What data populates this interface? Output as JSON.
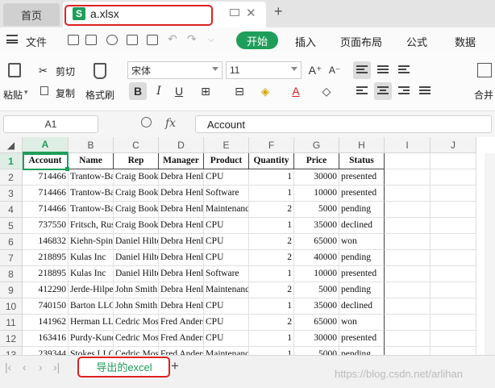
{
  "tabs": {
    "home": "首页",
    "file": "a.xlsx",
    "file_icon": "S",
    "close": "✕",
    "add": "+"
  },
  "menu": {
    "file": "文件",
    "start": "开始",
    "items": [
      "插入",
      "页面布局",
      "公式",
      "数据"
    ]
  },
  "ribbon": {
    "cut": "剪切",
    "copy": "复制",
    "paste": "粘贴",
    "format_painter": "格式刷",
    "font_name": "宋体",
    "font_size": "11",
    "bold": "B",
    "italic": "I",
    "underline": "U",
    "merge": "合并"
  },
  "formula": {
    "cell_ref": "A1",
    "fx": "fx",
    "content": "Account"
  },
  "columns": [
    "A",
    "B",
    "C",
    "D",
    "E",
    "F",
    "G",
    "H",
    "I",
    "J"
  ],
  "rows": [
    "1",
    "2",
    "3",
    "4",
    "5",
    "6",
    "7",
    "8",
    "9",
    "10",
    "11",
    "12",
    "13"
  ],
  "table": {
    "headers": [
      "Account",
      "Name",
      "Rep",
      "Manager",
      "Product",
      "Quantity",
      "Price",
      "Status"
    ],
    "data": [
      [
        "714466",
        "Trantow-Barrows",
        "Craig Booker",
        "Debra Henley",
        "CPU",
        "1",
        "30000",
        "presented"
      ],
      [
        "714466",
        "Trantow-Barrows",
        "Craig Booker",
        "Debra Henley",
        "Software",
        "1",
        "10000",
        "presented"
      ],
      [
        "714466",
        "Trantow-Barrows",
        "Craig Booker",
        "Debra Henley",
        "Maintenance",
        "2",
        "5000",
        "pending"
      ],
      [
        "737550",
        "Fritsch, Russel",
        "Craig Booker",
        "Debra Henley",
        "CPU",
        "1",
        "35000",
        "declined"
      ],
      [
        "146832",
        "Kiehn-Spinka",
        "Daniel Hilton",
        "Debra Henley",
        "CPU",
        "2",
        "65000",
        "won"
      ],
      [
        "218895",
        "Kulas Inc",
        "Daniel Hilton",
        "Debra Henley",
        "CPU",
        "2",
        "40000",
        "pending"
      ],
      [
        "218895",
        "Kulas Inc",
        "Daniel Hilton",
        "Debra Henley",
        "Software",
        "1",
        "10000",
        "presented"
      ],
      [
        "412290",
        "Jerde-Hilpert",
        "John Smith",
        "Debra Henley",
        "Maintenance",
        "2",
        "5000",
        "pending"
      ],
      [
        "740150",
        "Barton LLC",
        "John Smith",
        "Debra Henley",
        "CPU",
        "1",
        "35000",
        "declined"
      ],
      [
        "141962",
        "Herman LLC",
        "Cedric Moss",
        "Fred Anderson",
        "CPU",
        "2",
        "65000",
        "won"
      ],
      [
        "163416",
        "Purdy-Kunde",
        "Cedric Moss",
        "Fred Anderson",
        "CPU",
        "1",
        "30000",
        "presented"
      ],
      [
        "239344",
        "Stokes LLC",
        "Cedric Moss",
        "Fred Anderson",
        "Maintenance",
        "1",
        "5000",
        "pending"
      ]
    ]
  },
  "sheet": {
    "name": "导出的excel",
    "add": "+"
  },
  "watermark": "https://blog.csdn.net/arlihan",
  "colors": {
    "accent": "#1e9e5a",
    "highlight": "#e02020"
  }
}
